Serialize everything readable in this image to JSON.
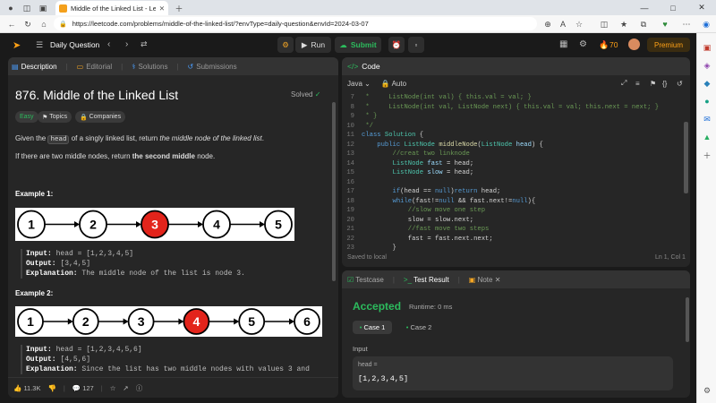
{
  "browser": {
    "tab_title": "Middle of the Linked List - LeetC",
    "url": "https://leetcode.com/problems/middle-of-the-linked-list/?envType=daily-question&envId=2024-03-07"
  },
  "header": {
    "title": "Daily Question",
    "run_label": "Run",
    "submit_label": "Submit",
    "streak_count": "70",
    "premium_label": "Premium"
  },
  "left": {
    "tabs": [
      "Description",
      "Editorial",
      "Solutions",
      "Submissions"
    ],
    "problem_title": "876. Middle of the Linked List",
    "solved_label": "Solved",
    "chips": [
      "Easy",
      "Topics",
      "Companies"
    ],
    "desc_given": "Given the ",
    "desc_head": "head",
    "desc_rest": " of a singly linked list, return ",
    "desc_italic": "the middle node of the linked list",
    "desc_end": ".",
    "desc2_start": "If there are two middle nodes, return ",
    "desc2_bold": "the second middle",
    "desc2_end": " node.",
    "example1": {
      "label": "Example 1:",
      "nodes": [
        "1",
        "2",
        "3",
        "4",
        "5"
      ],
      "highlight": 2,
      "input_label": "Input:",
      "input": "head = [1,2,3,4,5]",
      "output_label": "Output:",
      "output": "[3,4,5]",
      "explanation_label": "Explanation:",
      "explanation": "The middle node of the list is node 3."
    },
    "example2": {
      "label": "Example 2:",
      "nodes": [
        "1",
        "2",
        "3",
        "4",
        "5",
        "6"
      ],
      "highlight": 3,
      "input_label": "Input:",
      "input": "head = [1,2,3,4,5,6]",
      "output_label": "Output:",
      "output": "[4,5,6]",
      "explanation_label": "Explanation:",
      "explanation": "Since the list has two middle nodes with values 3 and"
    },
    "likes": "11.3K",
    "comments": "127"
  },
  "code": {
    "title": "Code",
    "language": "Java",
    "mode": "Auto",
    "lines": [
      {
        "n": "7",
        "html": "<span class='cm'> *     ListNode(int val) { this.val = val; }</span>"
      },
      {
        "n": "8",
        "html": "<span class='cm'> *     ListNode(int val, ListNode next) { this.val = val; this.next = next; }</span>"
      },
      {
        "n": "9",
        "html": "<span class='cm'> * }</span>"
      },
      {
        "n": "10",
        "html": "<span class='cm'> */</span>"
      },
      {
        "n": "11",
        "html": "<span class='kw'>class</span> <span class='ty'>Solution</span> <span class='plain'>{</span>"
      },
      {
        "n": "12",
        "html": "<span class='plain'>    </span><span class='kw'>public</span> <span class='ty'>ListNode</span> <span class='fn'>middleNode</span><span class='plain'>(</span><span class='ty'>ListNode</span> <span class='cyan'>head</span><span class='plain'>) {</span>"
      },
      {
        "n": "13",
        "html": "<span class='cm'>        //creat two linknode</span>"
      },
      {
        "n": "14",
        "html": "<span class='plain'>        </span><span class='ty'>ListNode</span> <span class='cyan'>fast</span> <span class='plain'>= head;</span>"
      },
      {
        "n": "15",
        "html": "<span class='plain'>        </span><span class='ty'>ListNode</span> <span class='cyan'>slow</span> <span class='plain'>= head;</span>"
      },
      {
        "n": "16",
        "html": ""
      },
      {
        "n": "17",
        "html": "<span class='plain'>        </span><span class='kw'>if</span><span class='plain'>(head == </span><span class='kw'>null</span><span class='plain'>)</span><span class='kw'>return</span><span class='plain'> head;</span>"
      },
      {
        "n": "18",
        "html": "<span class='plain'>        </span><span class='kw'>while</span><span class='plain'>(fast!=</span><span class='kw'>null</span><span class='plain'> &amp;&amp; fast.next!=</span><span class='kw'>null</span><span class='plain'>){</span>"
      },
      {
        "n": "19",
        "html": "<span class='cm'>            //slow move one step</span>"
      },
      {
        "n": "20",
        "html": "<span class='plain'>            slow = slow.next;</span>"
      },
      {
        "n": "21",
        "html": "<span class='cm'>            //fast move two steps</span>"
      },
      {
        "n": "22",
        "html": "<span class='plain'>            fast = fast.next.next;</span>"
      },
      {
        "n": "23",
        "html": "<span class='plain'>        }</span>"
      }
    ],
    "saved": "Saved to local",
    "cursor": "Ln 1, Col 1"
  },
  "test": {
    "tabs": [
      "Testcase",
      "Test Result",
      "Note"
    ],
    "status": "Accepted",
    "runtime": "Runtime: 0 ms",
    "cases": [
      "Case 1",
      "Case 2"
    ],
    "input_label": "Input",
    "var_name": "head =",
    "var_value": "[1,2,3,4,5]"
  }
}
